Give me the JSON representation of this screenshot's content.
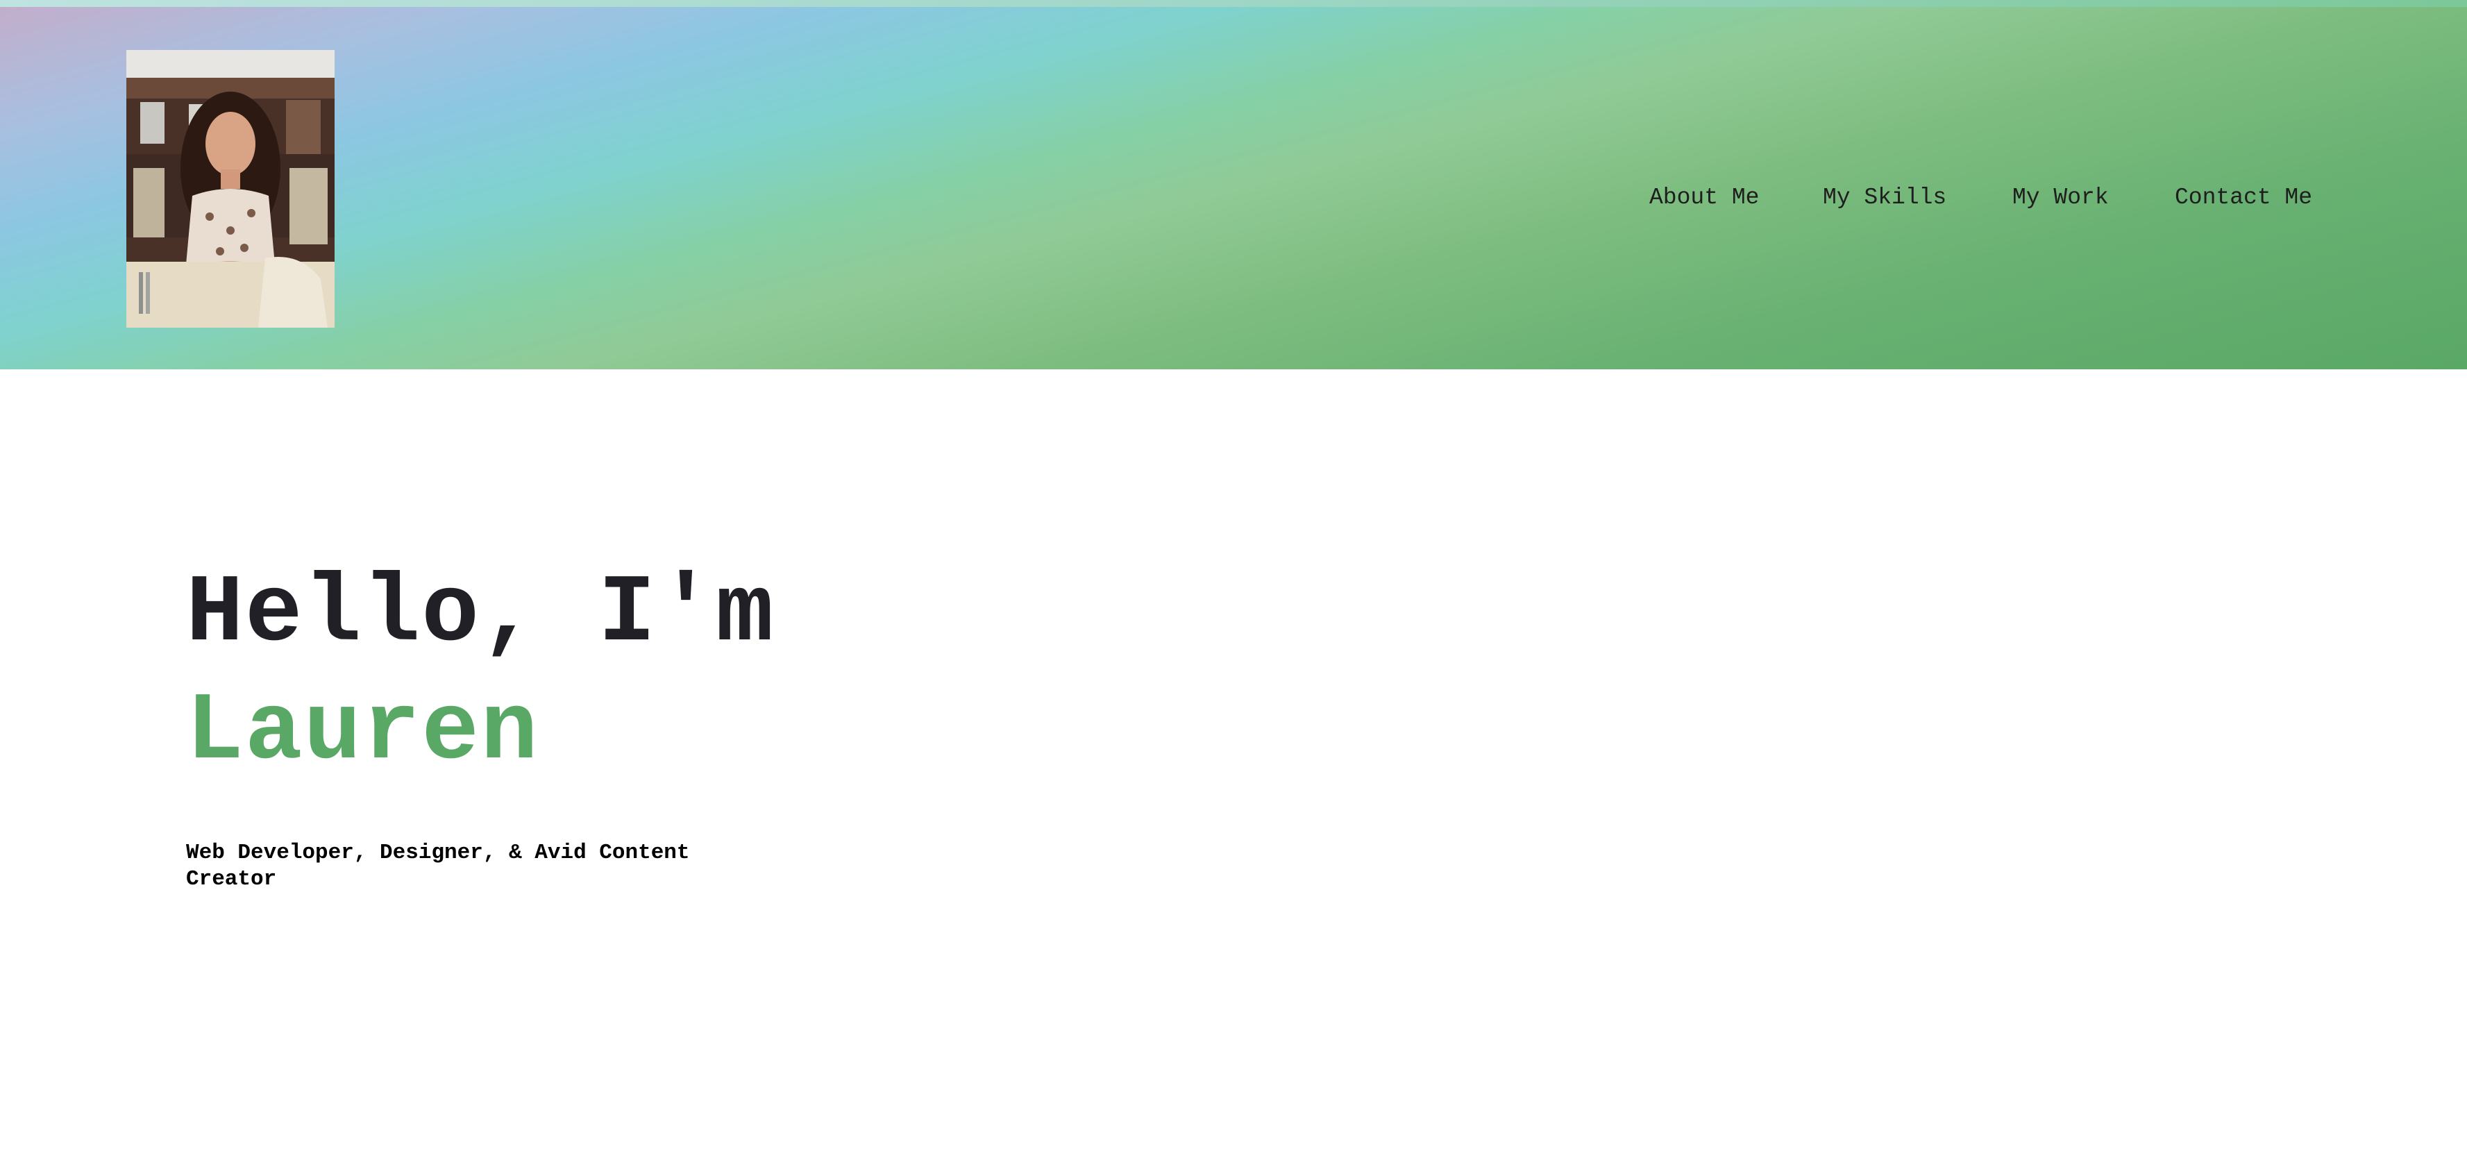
{
  "colors": {
    "accent": "#5aa866",
    "heading": "#212026",
    "nav_text": "#1e1e1e",
    "background": "#ffffff"
  },
  "header": {
    "avatar_icon": "profile-photo",
    "nav": [
      {
        "label": "About Me"
      },
      {
        "label": "My Skills"
      },
      {
        "label": "My Work"
      },
      {
        "label": "Contact Me"
      }
    ]
  },
  "hero": {
    "greeting": "Hello, I'm",
    "name": "Lauren",
    "tagline": "Web Developer, Designer, & Avid Content Creator"
  }
}
